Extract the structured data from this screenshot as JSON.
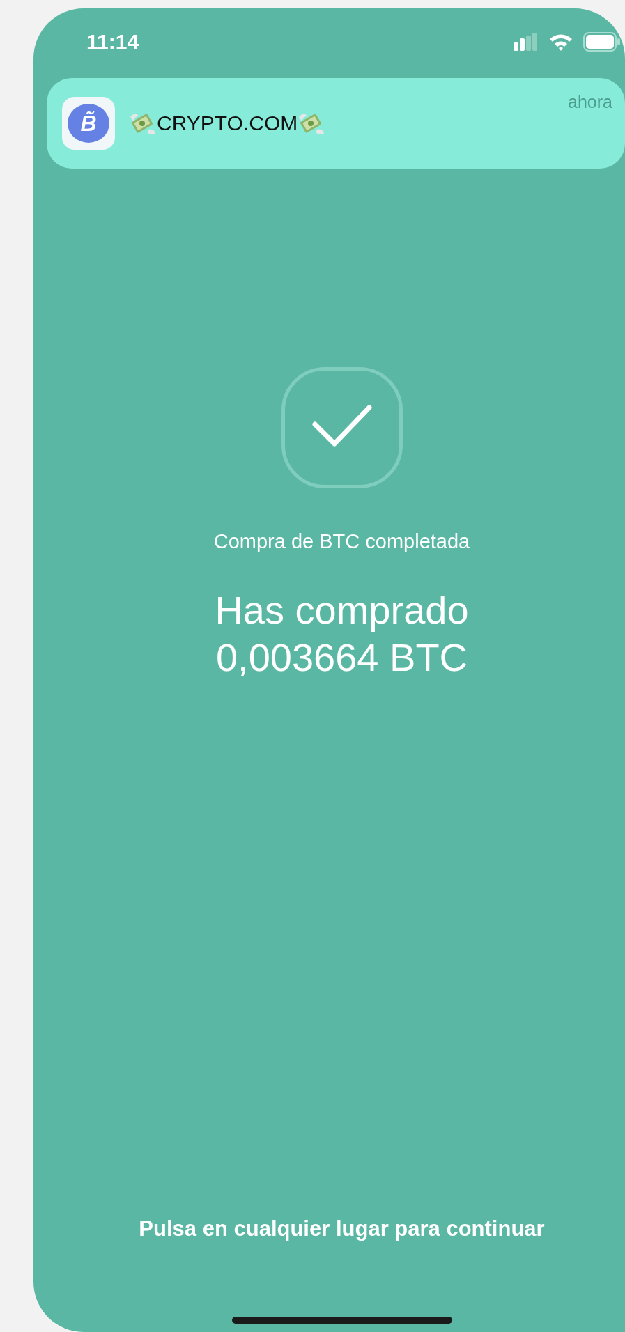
{
  "status_bar": {
    "time": "11:14"
  },
  "notification": {
    "icon_letter": "B̃",
    "title": "CRYPTO.COM",
    "time": "ahora"
  },
  "confirmation": {
    "subtitle": "Compra de BTC completada",
    "headline": [
      "Has comprado",
      "0,003664 BTC"
    ]
  },
  "footer": {
    "hint": "Pulsa en cualquier lugar para continuar"
  }
}
